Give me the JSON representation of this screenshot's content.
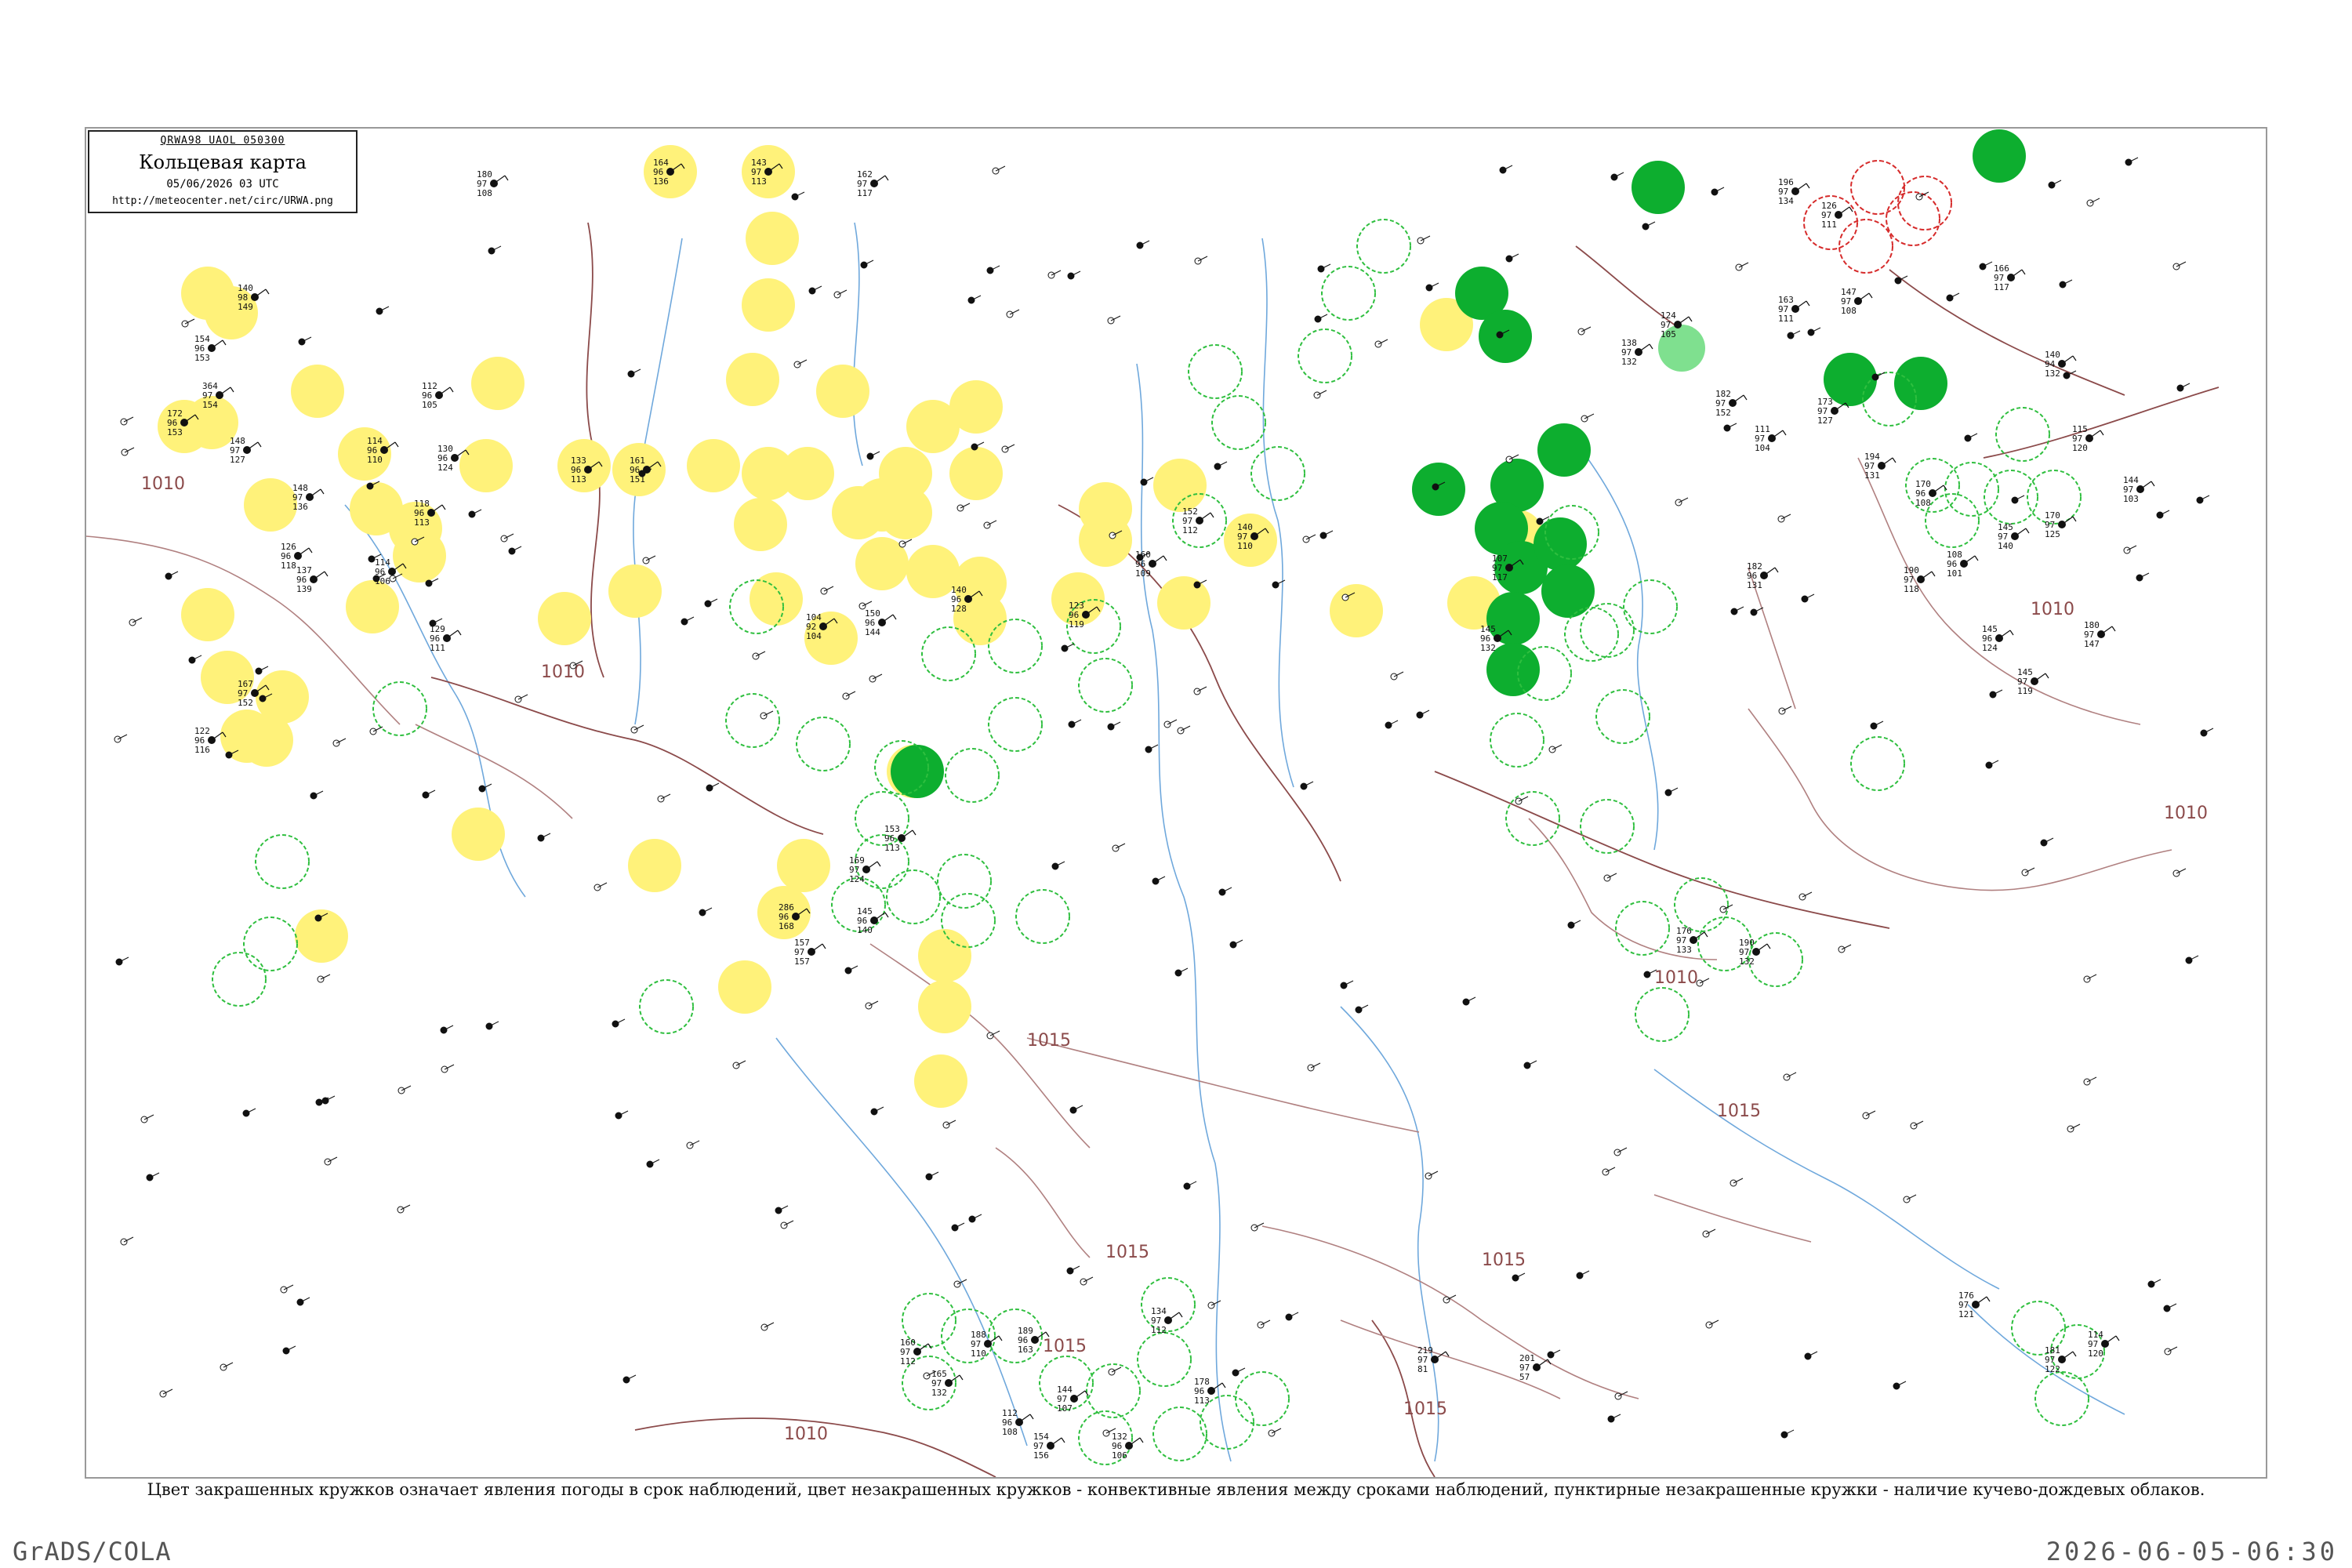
{
  "header": {
    "code": "QRWA98  UAOL  050300",
    "title": "Кольцевая карта",
    "datetime": "05/06/2026 03 UTC",
    "url": "http://meteocenter.net/circ/URWA.png"
  },
  "caption": "Цвет закрашенных кружков означает явления погоды в срок наблюдений, цвет незакрашенных кружков - конвективные явления между сроками наблюдений, пунктирные незакрашенные кружки - наличие кучево-дождевых облаков.",
  "footer": {
    "left": "GrADS/COLA",
    "right": "2026-06-05-06:30"
  },
  "colors": {
    "drizzle_fill": "#fff27a",
    "rain_fill": "#0dae2f",
    "light_rain_fill": "#7fe08f",
    "cb_outline": "#2fbf3f",
    "thunder_outline": "#d62a2a",
    "isobar": "#8b4a4a",
    "river": "#6fa8dc",
    "border": "#8b4a4a"
  },
  "isobars": [
    {
      "label": "1010"
    },
    {
      "label": "1010"
    },
    {
      "label": "1010"
    },
    {
      "label": "1010"
    },
    {
      "label": "1015"
    },
    {
      "label": "1015"
    },
    {
      "label": "1015"
    },
    {
      "label": "1015"
    },
    {
      "label": "1015"
    },
    {
      "label": "1015"
    },
    {
      "label": "1010"
    },
    {
      "label": "1010"
    }
  ],
  "stations": [
    {
      "p": "143",
      "t": "97",
      "d": "113"
    },
    {
      "p": "164",
      "t": "96",
      "d": "136"
    },
    {
      "p": "162",
      "t": "97",
      "d": "117"
    },
    {
      "p": "180",
      "t": "97",
      "d": "108"
    },
    {
      "p": "140",
      "t": "98",
      "d": "149"
    },
    {
      "p": "154",
      "t": "96",
      "d": "153"
    },
    {
      "p": "364",
      "t": "97",
      "d": "154"
    },
    {
      "p": "172",
      "t": "96",
      "d": "153"
    },
    {
      "p": "148",
      "t": "97",
      "d": "127"
    },
    {
      "p": "130",
      "t": "96",
      "d": "124"
    },
    {
      "p": "118",
      "t": "96",
      "d": "113"
    },
    {
      "p": "148",
      "t": "97",
      "d": "136"
    },
    {
      "p": "137",
      "t": "96",
      "d": "139"
    },
    {
      "p": "167",
      "t": "97",
      "d": "152"
    },
    {
      "p": "122",
      "t": "96",
      "d": "116"
    },
    {
      "p": "129",
      "t": "96",
      "d": "111"
    },
    {
      "p": "114",
      "t": "96",
      "d": "106"
    },
    {
      "p": "126",
      "t": "96",
      "d": "118"
    },
    {
      "p": "112",
      "t": "96",
      "d": "105"
    },
    {
      "p": "133",
      "t": "96",
      "d": "113"
    },
    {
      "p": "114",
      "t": "96",
      "d": "110"
    },
    {
      "p": "140",
      "t": "96",
      "d": "128"
    },
    {
      "p": "104",
      "t": "92",
      "d": "104"
    },
    {
      "p": "150",
      "t": "96",
      "d": "144"
    },
    {
      "p": "161",
      "t": "96",
      "d": "151"
    },
    {
      "p": "160",
      "t": "96",
      "d": "109"
    },
    {
      "p": "286",
      "t": "96",
      "d": "168"
    },
    {
      "p": "145",
      "t": "96",
      "d": "140"
    },
    {
      "p": "157",
      "t": "97",
      "d": "157"
    },
    {
      "p": "153",
      "t": "96",
      "d": "113"
    },
    {
      "p": "169",
      "t": "97",
      "d": "124"
    },
    {
      "p": "123",
      "t": "96",
      "d": "119"
    },
    {
      "p": "152",
      "t": "97",
      "d": "112"
    },
    {
      "p": "140",
      "t": "97",
      "d": "110"
    },
    {
      "p": "138",
      "t": "97",
      "d": "132"
    },
    {
      "p": "107",
      "t": "97",
      "d": "117"
    },
    {
      "p": "145",
      "t": "96",
      "d": "132"
    },
    {
      "p": "182",
      "t": "96",
      "d": "131"
    },
    {
      "p": "140",
      "t": "94",
      "d": "132"
    },
    {
      "p": "115",
      "t": "97",
      "d": "120"
    },
    {
      "p": "144",
      "t": "97",
      "d": "103"
    },
    {
      "p": "176",
      "t": "97",
      "d": "133"
    },
    {
      "p": "190",
      "t": "97",
      "d": "132"
    },
    {
      "p": "170",
      "t": "96",
      "d": "108"
    },
    {
      "p": "134",
      "t": "97",
      "d": "112"
    },
    {
      "p": "178",
      "t": "96",
      "d": "113"
    },
    {
      "p": "132",
      "t": "96",
      "d": "106"
    },
    {
      "p": "144",
      "t": "97",
      "d": "107"
    },
    {
      "p": "189",
      "t": "96",
      "d": "163"
    },
    {
      "p": "188",
      "t": "97",
      "d": "110"
    },
    {
      "p": "154",
      "t": "97",
      "d": "156"
    },
    {
      "p": "112",
      "t": "96",
      "d": "108"
    },
    {
      "p": "160",
      "t": "97",
      "d": "112"
    },
    {
      "p": "165",
      "t": "97",
      "d": "132"
    },
    {
      "p": "176",
      "t": "97",
      "d": "121"
    },
    {
      "p": "181",
      "t": "97",
      "d": "122"
    },
    {
      "p": "114",
      "t": "97",
      "d": "120"
    },
    {
      "p": "108",
      "t": "96",
      "d": "101"
    },
    {
      "p": "145",
      "t": "96",
      "d": "124"
    },
    {
      "p": "145",
      "t": "97",
      "d": "119"
    },
    {
      "p": "111",
      "t": "97",
      "d": "104"
    },
    {
      "p": "163",
      "t": "97",
      "d": "111"
    },
    {
      "p": "147",
      "t": "97",
      "d": "108"
    },
    {
      "p": "173",
      "t": "97",
      "d": "127"
    },
    {
      "p": "194",
      "t": "97",
      "d": "131"
    },
    {
      "p": "190",
      "t": "97",
      "d": "118"
    },
    {
      "p": "170",
      "t": "97",
      "d": "125"
    },
    {
      "p": "145",
      "t": "97",
      "d": "140"
    },
    {
      "p": "196",
      "t": "97",
      "d": "134"
    },
    {
      "p": "126",
      "t": "97",
      "d": "111"
    },
    {
      "p": "166",
      "t": "97",
      "d": "117"
    },
    {
      "p": "124",
      "t": "97",
      "d": "105"
    },
    {
      "p": "182",
      "t": "97",
      "d": "152"
    },
    {
      "p": "180",
      "t": "97",
      "d": "147"
    },
    {
      "p": "201",
      "t": "97",
      "d": "57"
    },
    {
      "p": "219",
      "t": "97",
      "d": "81"
    }
  ]
}
